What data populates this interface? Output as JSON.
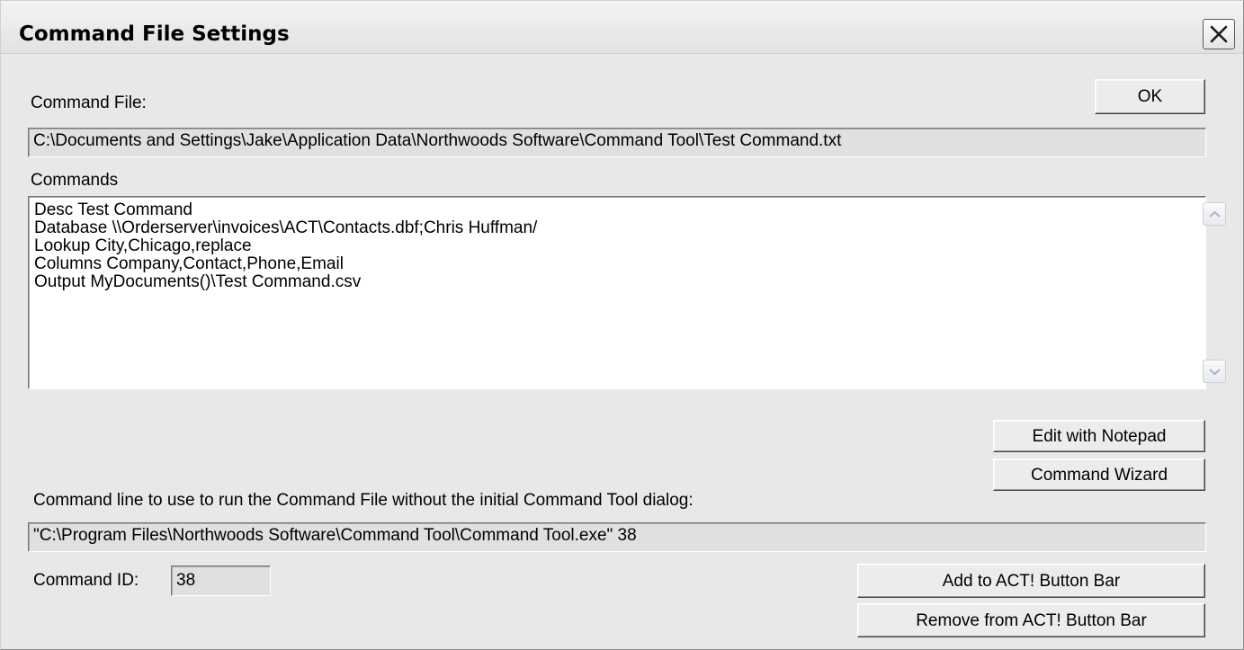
{
  "window": {
    "title": "Command File Settings"
  },
  "command_file": {
    "label": "Command File:",
    "path": "C:\\Documents and Settings\\Jake\\Application Data\\Northwoods Software\\Command Tool\\Test Command.txt"
  },
  "buttons": {
    "ok": "OK",
    "edit_notepad": "Edit with Notepad",
    "command_wizard": "Command Wizard",
    "add_button_bar": "Add to ACT! Button Bar",
    "remove_button_bar": "Remove from ACT! Button Bar"
  },
  "commands": {
    "label": "Commands",
    "lines": [
      "Desc Test Command",
      "Database \\\\Orderserver\\invoices\\ACT\\Contacts.dbf;Chris Huffman/",
      "Lookup City,Chicago,replace",
      "Columns Company,Contact,Phone,Email",
      "Output MyDocuments()\\Test Command.csv"
    ]
  },
  "command_line": {
    "label": "Command line to use to run the Command File without the initial Command Tool dialog:",
    "value": "\"C:\\Program Files\\Northwoods Software\\Command Tool\\Command Tool.exe\" 38"
  },
  "command_id": {
    "label": "Command ID:",
    "value": "38"
  },
  "icons": {
    "close": "close-icon",
    "scroll_up": "chevron-up-icon",
    "scroll_down": "chevron-down-icon"
  }
}
